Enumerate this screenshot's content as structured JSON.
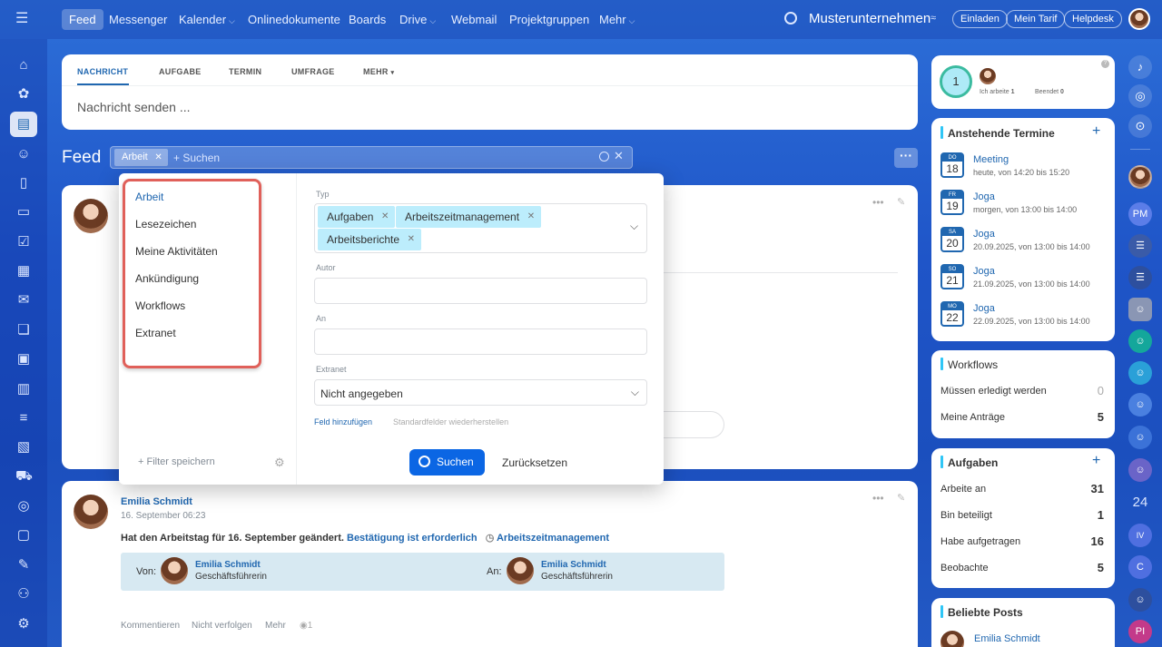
{
  "topnav": {
    "items": [
      "Feed",
      "Messenger",
      "Kalender",
      "Onlinedokumente",
      "Boards",
      "Drive",
      "Webmail",
      "Projektgruppen",
      "Mehr"
    ],
    "company": "Musterunternehmen",
    "invite": "Einladen",
    "plan": "Mein Tarif",
    "helpdesk": "Helpdesk"
  },
  "composer": {
    "tabs": [
      "NACHRICHT",
      "AUFGABE",
      "TERMIN",
      "UMFRAGE",
      "MEHR"
    ],
    "placeholder": "Nachricht senden ..."
  },
  "feed": {
    "title": "Feed",
    "filter_chip": "Arbeit",
    "search_placeholder": "+ Suchen"
  },
  "filter": {
    "presets": [
      "Arbeit",
      "Lesezeichen",
      "Meine Aktivitäten",
      "Ankündigung",
      "Workflows",
      "Extranet"
    ],
    "save_filter": "Filter speichern",
    "type_label": "Typ",
    "type_tags": [
      "Aufgaben",
      "Arbeitszeitmanagement",
      "Arbeitsberichte"
    ],
    "author_label": "Autor",
    "to_label": "An",
    "extranet_label": "Extranet",
    "extranet_value": "Nicht angegeben",
    "add_field": "Feld hinzufügen",
    "restore_fields": "Standardfelder wiederherstellen",
    "search_btn": "Suchen",
    "reset_btn": "Zurücksetzen"
  },
  "post": {
    "author": "Emilia Schmidt",
    "date": "16. September 06:23",
    "text": "Hat den Arbeitstag für 16. September geändert.",
    "confirm": "Bestätigung ist erforderlich",
    "module": "Arbeitszeitmanagement",
    "from_label": "Von:",
    "to_label": "An:",
    "from_name": "Emilia Schmidt",
    "from_role": "Geschäftsführerin",
    "to_name": "Emilia Schmidt",
    "to_role": "Geschäftsführerin",
    "actions": [
      "Kommentieren",
      "Nicht verfolgen",
      "Mehr"
    ],
    "views": "1"
  },
  "worktime": {
    "count": "1",
    "working_label": "Ich arbeite",
    "working_count": "1",
    "done_label": "Beendet",
    "done_count": "0"
  },
  "events": {
    "title": "Anstehende Termine",
    "items": [
      {
        "day": "DO",
        "num": "18",
        "title": "Meeting",
        "time": "heute, von 14:20 bis 15:20"
      },
      {
        "day": "FR",
        "num": "19",
        "title": "Joga",
        "time": "morgen, von 13:00 bis 14:00"
      },
      {
        "day": "SA",
        "num": "20",
        "title": "Joga",
        "time": "20.09.2025, von 13:00 bis 14:00"
      },
      {
        "day": "SO",
        "num": "21",
        "title": "Joga",
        "time": "21.09.2025, von 13:00 bis 14:00"
      },
      {
        "day": "MO",
        "num": "22",
        "title": "Joga",
        "time": "22.09.2025, von 13:00 bis 14:00"
      }
    ]
  },
  "workflows": {
    "title": "Workflows",
    "rows": [
      {
        "label": "Müssen erledigt werden",
        "value": "0"
      },
      {
        "label": "Meine Anträge",
        "value": "5"
      }
    ]
  },
  "tasks": {
    "title": "Aufgaben",
    "rows": [
      {
        "label": "Arbeite an",
        "value": "31"
      },
      {
        "label": "Bin beteiligt",
        "value": "1"
      },
      {
        "label": "Habe aufgetragen",
        "value": "16"
      },
      {
        "label": "Beobachte",
        "value": "5"
      }
    ]
  },
  "popular": {
    "title": "Beliebte Posts",
    "author": "Emilia Schmidt"
  },
  "right_rail": {
    "badges": [
      "PM",
      "24",
      "IV",
      "C",
      "PI"
    ]
  },
  "colors": {
    "accent": "#2067b0",
    "primary_button": "#0b66e4",
    "tag_bg": "#bcedfc",
    "highlight_border": "#e0605a"
  }
}
